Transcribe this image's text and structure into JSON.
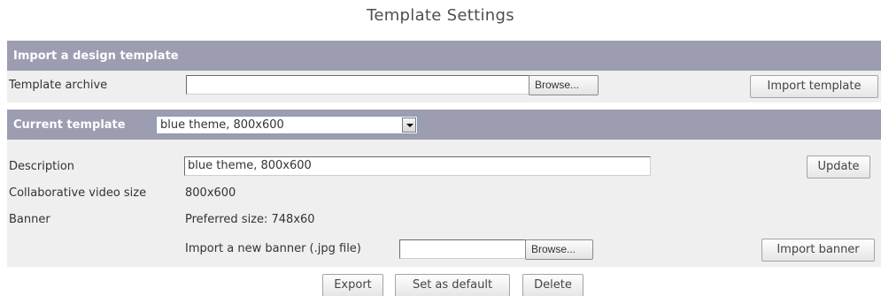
{
  "page": {
    "title": "Template Settings"
  },
  "import_section": {
    "header": "Import a design template",
    "archive_label": "Template archive",
    "archive_value": "",
    "browse_label": "Browse...",
    "import_button": "Import template"
  },
  "current_section": {
    "header": "Current template",
    "selected_template": "blue theme, 800x600",
    "description_label": "Description",
    "description_value": "blue theme, 800x600",
    "update_button": "Update",
    "video_size_label": "Collaborative video size",
    "video_size_value": "800x600",
    "banner_label": "Banner",
    "banner_preferred": "Preferred size: 748x60",
    "banner_import_label": "Import a new banner (.jpg file)",
    "banner_file_value": "",
    "browse_label": "Browse...",
    "import_banner_button": "Import banner"
  },
  "actions": {
    "export": "Export",
    "set_default": "Set as default",
    "delete": "Delete"
  },
  "colors": {
    "header_bg": "#9c9db1",
    "panel_bg": "#efefef",
    "title_text": "#4e4e4e"
  }
}
